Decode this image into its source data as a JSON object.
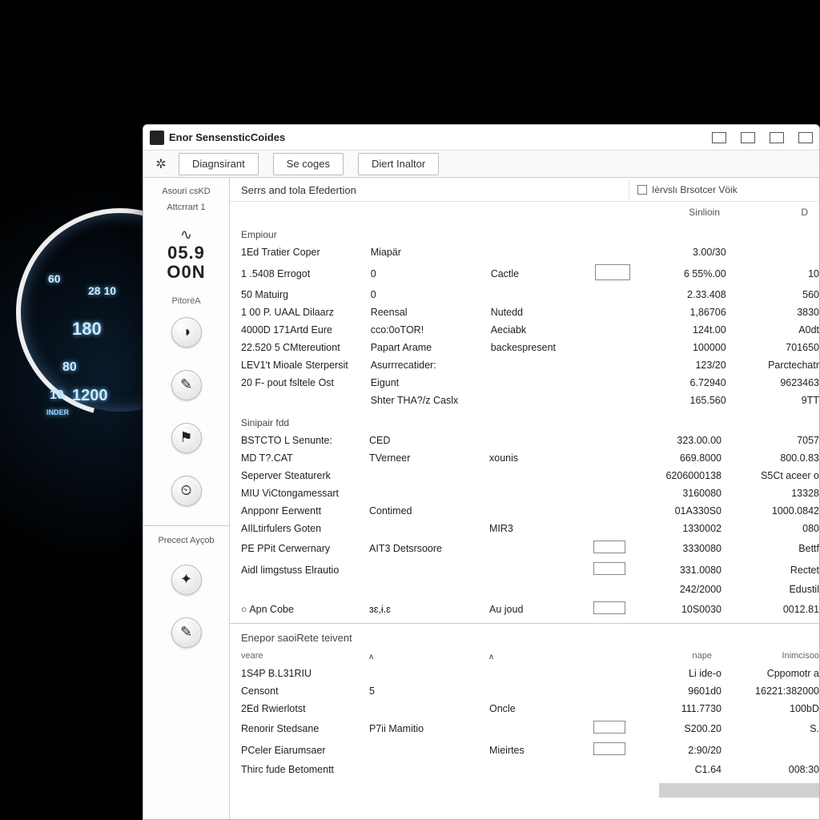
{
  "gauge": {
    "n60": "60",
    "n2810": "28 10",
    "n180": "180",
    "n80": "80",
    "n10": "10",
    "n1200": "1200",
    "unit": "INDER"
  },
  "window": {
    "title": "Enor SensensticCoides"
  },
  "toolbar": {
    "tabs": [
      "Diagnsirant",
      "Se coges",
      "Diert Inaltor"
    ]
  },
  "sidebar": {
    "top1": "Asouri csKD",
    "top2": "Attcrrart 1",
    "glyph": "∿",
    "big1": "05.9",
    "big2": "O0N",
    "section1": "PitorèA",
    "footer": "Precect Ayçob"
  },
  "header": {
    "section": "Serrs and tola Efedertion",
    "right_label": "Ièrvslı Brsotcer Vöik",
    "col1": "Sinlioin",
    "col2": "D"
  },
  "group1": {
    "label": "Empiour",
    "rows": [
      {
        "c1": "1Ed Tratier Coper",
        "c2": "Miapär",
        "c3": "",
        "box": false,
        "c5": "3.00/30",
        "c6": ""
      },
      {
        "c1": "1 .5408 Errogot",
        "c2": "0",
        "c3": "Cactle",
        "box": true,
        "c5": "6 55%.00",
        "c6": "10"
      },
      {
        "c1": "50 Matuirg",
        "c2": "0",
        "c3": "",
        "box": false,
        "c5": "2.33.408",
        "c6": "560"
      },
      {
        "c1": "1 00 P. UAAL Dilaarz",
        "c2": "Reensal",
        "c3": "Nutedd",
        "box": false,
        "c5": "1,86706",
        "c6": "3830"
      },
      {
        "c1": "4000D 171Artd Eure",
        "c2": "cco:0oTOR!",
        "c3": "Aeciabk",
        "box": false,
        "c5": "124t.00",
        "c6": "A0dt"
      },
      {
        "c1": "22.520 5 CMtereutiont",
        "c2": "Papart Arame",
        "c3": "backespresent",
        "box": false,
        "c5": "100000",
        "c6": "701650"
      },
      {
        "c1": "LEV1't Mioale Sterpersit",
        "c2": "Asurrrecatider:",
        "c3": "",
        "box": false,
        "c5": "123/20",
        "c6": "Parctechatr"
      },
      {
        "c1": "20 F- pout fsltele Ost",
        "c2": "Eigunt",
        "c3": "",
        "box": false,
        "c5": "6.72940",
        "c6": "9623463"
      },
      {
        "c1": "",
        "c2": "Shter THA?/z Caslx",
        "c3": "",
        "box": false,
        "c5": "165.560",
        "c6": "9TT"
      }
    ]
  },
  "group2": {
    "label": "Sinipair fdd",
    "rows": [
      {
        "c1": "BSTCTO L Senunte:",
        "c2": "CED",
        "c3": "",
        "box": false,
        "c5": "323.00.00",
        "c6": "7057"
      },
      {
        "c1": "MD T?.CAT",
        "c2": "TVerneer",
        "c3": "xounis",
        "box": false,
        "c5": "669.8000",
        "c6": "800.0.83"
      },
      {
        "c1": "Seperver Steaturerk",
        "c2": "",
        "c3": "",
        "box": false,
        "c5": "6206000138",
        "c6": "S5Ct aceer o"
      },
      {
        "c1": "MIU ViCtongamessart",
        "c2": "",
        "c3": "",
        "box": false,
        "c5": "3160080",
        "c6": "13328"
      },
      {
        "c1": "Anpponr Eerwentt",
        "c2": "Contimed",
        "c3": "",
        "box": false,
        "c5": "01A330S0",
        "c6": "1000.0842"
      },
      {
        "c1": "AIlLtirfulers Goten",
        "c2": "",
        "c3": "MIR3",
        "box": false,
        "c5": "1330002",
        "c6": "080"
      },
      {
        "c1": "PE PPit Cerwernary",
        "c2": "AIT3 Detsrsoore",
        "c3": "",
        "box": true,
        "c5": "3330080",
        "c6": "Bettf"
      },
      {
        "c1": "Aidl limgstuss Elrautio",
        "c2": "",
        "c3": "",
        "box": true,
        "c5": "331.0080",
        "c6": "Rectet"
      },
      {
        "c1": "",
        "c2": "",
        "c3": "",
        "box": false,
        "c5": "242/2000",
        "c6": "Edustil"
      },
      {
        "c1": "○  Apn Cobe",
        "c2": "ɜɛ,ɨ.ɛ",
        "c3": "Au joud",
        "box": true,
        "c5": "10S0030",
        "c6": "0012.81"
      }
    ]
  },
  "group3": {
    "label": "Enepor saoiRete teivent",
    "colA": "veare",
    "rows": [
      {
        "c1": "1S4P B.L31RIU",
        "c2": "",
        "c3": "",
        "box": false,
        "c5": "Li ide-o",
        "c6": "Cppomotr a"
      },
      {
        "c1": "Censont",
        "c2": "5",
        "c3": "",
        "box": false,
        "c5": "9601d0",
        "c6": "16221:382000"
      },
      {
        "c1": "2Ed Rwierlotst",
        "c2": "",
        "c3": "Oncle",
        "box": false,
        "c5": "111.7730",
        "c6": "100bD"
      },
      {
        "c1": "Renorir Stedsane",
        "c2": "P7ii Mamitio",
        "c3": "",
        "box": true,
        "c5": "S200.20",
        "c6": "S."
      },
      {
        "c1": "PCeler Eiarumsaer",
        "c2": "",
        "c3": "Mieirtes",
        "box": true,
        "c5": "2:90/20",
        "c6": ""
      },
      {
        "c1": "Thirc fude Betomentt",
        "c2": "",
        "c3": "",
        "box": false,
        "c5": "C1.64",
        "c6": "008:30"
      }
    ],
    "hdr_right1": "nape",
    "hdr_right2": "Inimcisoo"
  }
}
